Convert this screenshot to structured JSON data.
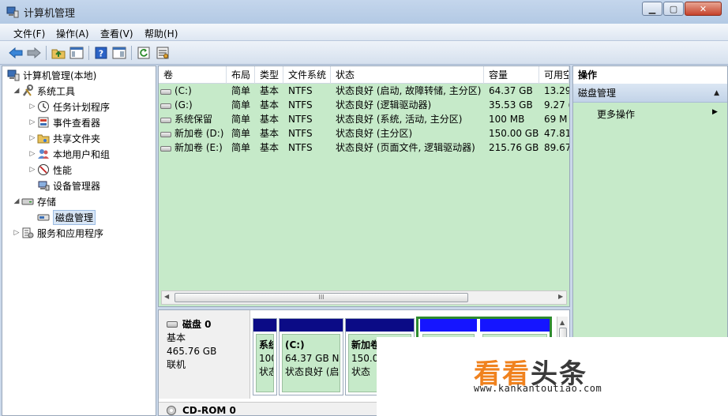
{
  "window": {
    "title": "计算机管理"
  },
  "menu": [
    "文件(F)",
    "操作(A)",
    "查看(V)",
    "帮助(H)"
  ],
  "tree": {
    "root": "计算机管理(本地)",
    "system_tools": "系统工具",
    "task_scheduler": "任务计划程序",
    "event_viewer": "事件查看器",
    "shared_folders": "共享文件夹",
    "local_users": "本地用户和组",
    "performance": "性能",
    "device_manager": "设备管理器",
    "storage": "存储",
    "disk_management": "磁盘管理",
    "services_apps": "服务和应用程序"
  },
  "volumes": {
    "headers": [
      "卷",
      "布局",
      "类型",
      "文件系统",
      "状态",
      "容量",
      "可用空"
    ],
    "rows": [
      [
        "(C:)",
        "简单",
        "基本",
        "NTFS",
        "状态良好 (启动, 故障转储, 主分区)",
        "64.37 GB",
        "13.29"
      ],
      [
        "(G:)",
        "简单",
        "基本",
        "NTFS",
        "状态良好 (逻辑驱动器)",
        "35.53 GB",
        "9.27 ("
      ],
      [
        "系统保留",
        "简单",
        "基本",
        "NTFS",
        "状态良好 (系统, 活动, 主分区)",
        "100 MB",
        "69 M"
      ],
      [
        "新加卷 (D:)",
        "简单",
        "基本",
        "NTFS",
        "状态良好 (主分区)",
        "150.00 GB",
        "47.81"
      ],
      [
        "新加卷 (E:)",
        "简单",
        "基本",
        "NTFS",
        "状态良好 (页面文件, 逻辑驱动器)",
        "215.76 GB",
        "89.67"
      ]
    ],
    "scroll_grip": "III"
  },
  "disk0": {
    "name": "磁盘 0",
    "type": "基本",
    "size": "465.76 GB",
    "status": "联机",
    "partitions": [
      {
        "name": "系统",
        "size": "100",
        "status": "状态"
      },
      {
        "name": "(C:)",
        "size": "64.37 GB N",
        "status": "状态良好 (启"
      },
      {
        "name": "新加卷",
        "size": "150.0",
        "status": "状态"
      }
    ]
  },
  "cdrom": {
    "name": "CD-ROM 0"
  },
  "actions": {
    "title": "操作",
    "section": "磁盘管理",
    "more": "更多操作"
  },
  "watermark": {
    "logo_a": "看看",
    "logo_b": "头条",
    "url": "www.kankantoutiao.com"
  },
  "colors": {
    "volume_bg": "#c6eac9",
    "primary_partition": "#0b0b86",
    "logical_partition": "#1515ff",
    "extended_frame": "#2e8b2e",
    "watermark_orange": "#f0821e"
  }
}
